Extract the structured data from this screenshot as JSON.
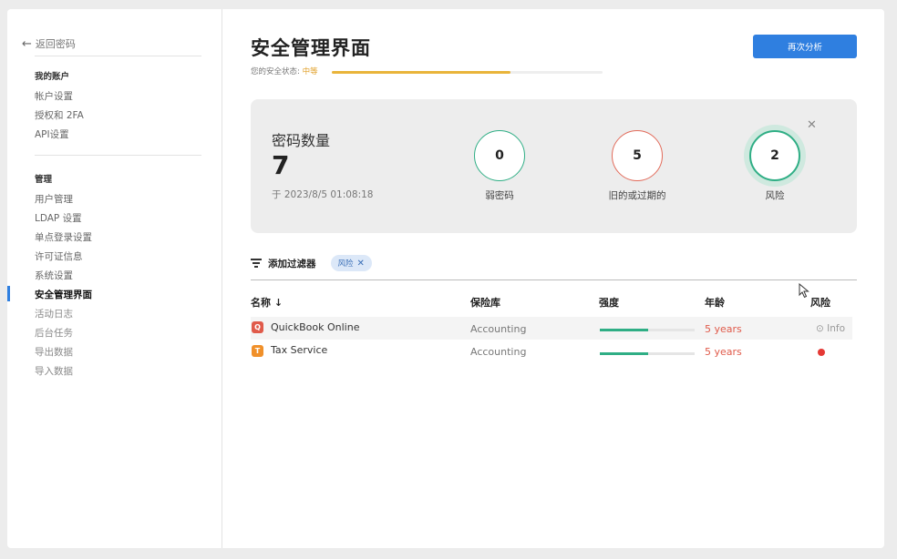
{
  "sidebar": {
    "back_label": "返回密码",
    "section_account": "我的账户",
    "account_items": [
      "帐户设置",
      "授权和 2FA",
      "API设置"
    ],
    "section_admin": "管理",
    "admin_items": [
      "用户管理",
      "LDAP 设置",
      "单点登录设置",
      "许可证信息",
      "系统设置",
      "安全管理界面",
      "活动日志",
      "后台任务",
      "导出数据",
      "导入数据"
    ]
  },
  "header": {
    "title": "安全管理界面",
    "status_label": "您的安全状态:",
    "status_value": "中等",
    "security_level": 0.66,
    "reanalyze_label": "再次分析"
  },
  "summary": {
    "count_label": "密码数量",
    "count": "7",
    "timestamp": "于 2023/8/5 01:08:18",
    "stats": [
      {
        "value": "0",
        "label": "弱密码",
        "color": "#2fae85"
      },
      {
        "value": "5",
        "label": "旧的或过期的",
        "color": "#e26b5a"
      },
      {
        "value": "2",
        "label": "风险",
        "color": "#2fae85"
      }
    ]
  },
  "filter": {
    "add_label": "添加过滤器",
    "chip_label": "风险"
  },
  "table": {
    "headers": {
      "name": "名称 ↓",
      "vault": "保险库",
      "strength": "强度",
      "age": "年龄",
      "risk": "风险"
    },
    "rows": [
      {
        "icon_letter": "Q",
        "icon_color": "#e05a4a",
        "name": "QuickBook Online",
        "vault": "Accounting",
        "strength": 0.51,
        "age": "5 years",
        "risk": "Info"
      },
      {
        "icon_letter": "T",
        "icon_color": "#f0902a",
        "name": "Tax Service",
        "vault": "Accounting",
        "strength": 0.51,
        "age": "5 years",
        "risk": ""
      }
    ]
  },
  "colors": {
    "accent": "#2f7fe0",
    "warning": "#e9b43a",
    "danger": "#e53935",
    "success": "#2fae85"
  }
}
